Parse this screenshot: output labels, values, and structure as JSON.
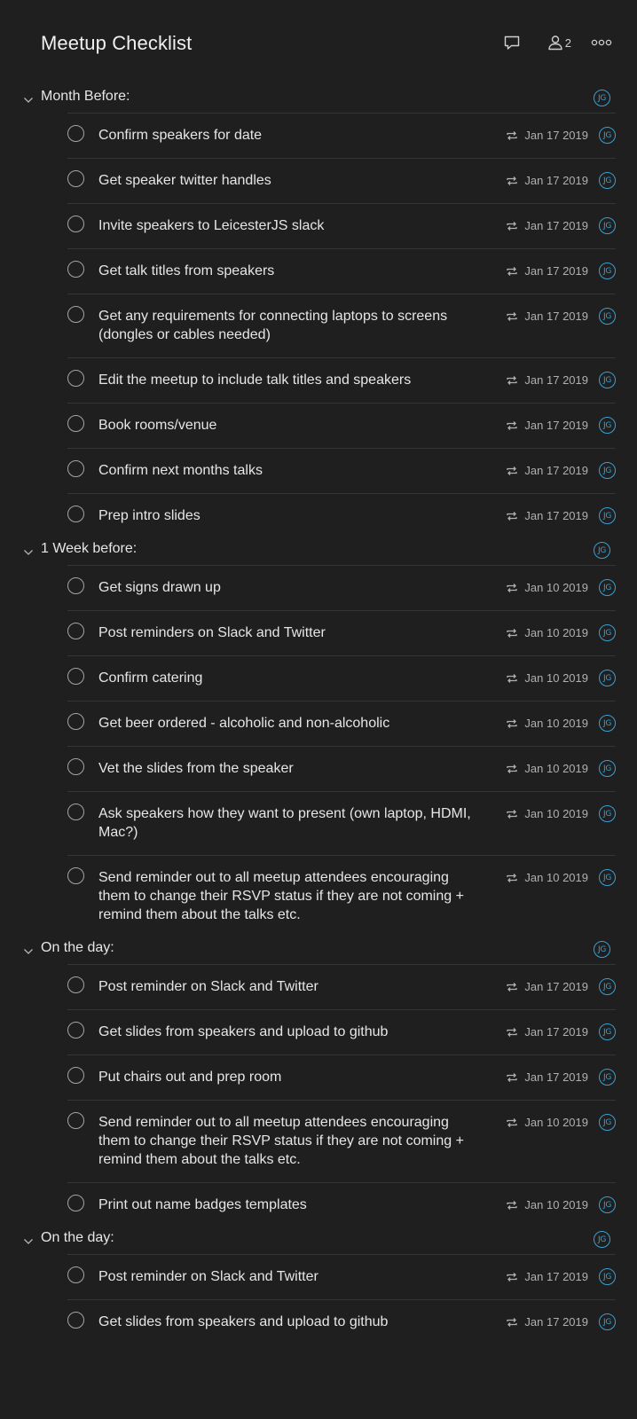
{
  "header": {
    "title": "Meetup Checklist",
    "member_count": "2",
    "icons": [
      "comment-icon",
      "person-icon",
      "more-icon"
    ]
  },
  "colors": {
    "background": "#1f1f1f",
    "accent": "#3b9fd1",
    "text": "#e6e6e6",
    "muted": "#b0b0b0"
  },
  "sections": [
    {
      "title": "Month Before:",
      "assignee": "JG",
      "tasks": [
        {
          "text": "Confirm speakers for date",
          "due": "Jan 17 2019",
          "assignee": "JG"
        },
        {
          "text": "Get speaker twitter handles",
          "due": "Jan 17 2019",
          "assignee": "JG"
        },
        {
          "text": "Invite speakers to LeicesterJS slack",
          "due": "Jan 17 2019",
          "assignee": "JG"
        },
        {
          "text": "Get talk titles from speakers",
          "due": "Jan 17 2019",
          "assignee": "JG"
        },
        {
          "text": "Get any requirements for connecting laptops to screens (dongles or cables needed)",
          "due": "Jan 17 2019",
          "assignee": "JG"
        },
        {
          "text": "Edit the meetup to include talk titles and speakers",
          "due": "Jan 17 2019",
          "assignee": "JG"
        },
        {
          "text": "Book rooms/venue",
          "due": "Jan 17 2019",
          "assignee": "JG"
        },
        {
          "text": "Confirm next months talks",
          "due": "Jan 17 2019",
          "assignee": "JG"
        },
        {
          "text": "Prep intro slides",
          "due": "Jan 17 2019",
          "assignee": "JG"
        }
      ]
    },
    {
      "title": "1 Week before:",
      "assignee": "JG",
      "tasks": [
        {
          "text": "Get signs drawn up",
          "due": "Jan 10 2019",
          "assignee": "JG"
        },
        {
          "text": "Post reminders on Slack and Twitter",
          "due": "Jan 10 2019",
          "assignee": "JG"
        },
        {
          "text": "Confirm catering",
          "due": "Jan 10 2019",
          "assignee": "JG"
        },
        {
          "text": "Get beer ordered - alcoholic and non-alcoholic",
          "due": "Jan 10 2019",
          "assignee": "JG"
        },
        {
          "text": "Vet the slides from the speaker",
          "due": "Jan 10 2019",
          "assignee": "JG"
        },
        {
          "text": "Ask speakers how they want to present (own laptop, HDMI, Mac?)",
          "due": "Jan 10 2019",
          "assignee": "JG"
        },
        {
          "text": "Send reminder out to all meetup attendees encouraging them to change their RSVP status if they are not coming + remind them about the talks etc.",
          "due": "Jan 10 2019",
          "assignee": "JG"
        }
      ]
    },
    {
      "title": "On the day:",
      "assignee": "JG",
      "tasks": [
        {
          "text": "Post reminder on Slack and Twitter",
          "due": "Jan 17 2019",
          "assignee": "JG"
        },
        {
          "text": "Get slides from speakers and upload to github",
          "due": "Jan 17 2019",
          "assignee": "JG"
        },
        {
          "text": "Put chairs out and prep room",
          "due": "Jan 17 2019",
          "assignee": "JG"
        },
        {
          "text": "Send reminder out to all meetup attendees encouraging them to change their RSVP status if they are not coming + remind them about the talks etc.",
          "due": "Jan 10 2019",
          "assignee": "JG"
        },
        {
          "text": "Print out name badges templates",
          "due": "Jan 10 2019",
          "assignee": "JG"
        }
      ]
    },
    {
      "title": "On the day:",
      "assignee": "JG",
      "tasks": [
        {
          "text": "Post reminder on Slack and Twitter",
          "due": "Jan 17 2019",
          "assignee": "JG"
        },
        {
          "text": "Get slides from speakers and upload to github",
          "due": "Jan 17 2019",
          "assignee": "JG"
        }
      ]
    }
  ]
}
